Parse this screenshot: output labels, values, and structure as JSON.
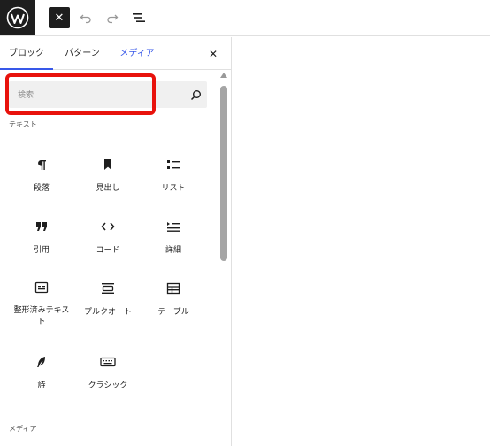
{
  "toolbar": {
    "logo": "wordpress-logo",
    "close_label": "✕"
  },
  "tabs": [
    {
      "label": "ブロック"
    },
    {
      "label": "パターン"
    },
    {
      "label": "メディア"
    }
  ],
  "search": {
    "placeholder": "検索"
  },
  "sections": {
    "text": "テキスト",
    "media": "メディア"
  },
  "blocks": [
    {
      "label": "段落",
      "icon": "paragraph-icon"
    },
    {
      "label": "見出し",
      "icon": "bookmark-icon"
    },
    {
      "label": "リスト",
      "icon": "list-icon"
    },
    {
      "label": "引用",
      "icon": "quote-icon"
    },
    {
      "label": "コード",
      "icon": "code-icon"
    },
    {
      "label": "詳細",
      "icon": "details-icon"
    },
    {
      "label": "整形済みテキスト",
      "icon": "preformatted-icon"
    },
    {
      "label": "プルクオート",
      "icon": "pullquote-icon"
    },
    {
      "label": "テーブル",
      "icon": "table-icon"
    },
    {
      "label": "詩",
      "icon": "verse-icon"
    },
    {
      "label": "クラシック",
      "icon": "keyboard-icon"
    }
  ],
  "colors": {
    "accent": "#3858e9",
    "highlight": "#e8120c",
    "dark": "#1e1e1e"
  }
}
